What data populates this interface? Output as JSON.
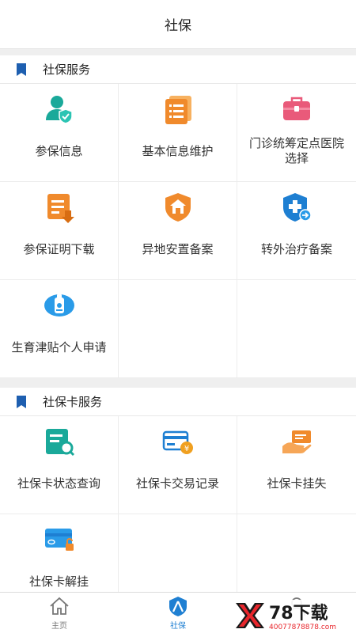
{
  "header": {
    "title": "社保"
  },
  "sections": [
    {
      "title": "社保服务",
      "items": [
        {
          "label": "参保信息",
          "icon": "user-shield-icon"
        },
        {
          "label": "基本信息维护",
          "icon": "document-list-icon"
        },
        {
          "label": "门诊统筹定点医院选择",
          "icon": "medical-kit-icon"
        },
        {
          "label": "参保证明下载",
          "icon": "download-document-icon"
        },
        {
          "label": "异地安置备案",
          "icon": "house-shield-icon"
        },
        {
          "label": "转外治疗备案",
          "icon": "medical-shield-transfer-icon"
        },
        {
          "label": "生育津贴个人申请",
          "icon": "baby-bottle-icon"
        }
      ]
    },
    {
      "title": "社保卡服务",
      "items": [
        {
          "label": "社保卡状态查询",
          "icon": "card-search-icon"
        },
        {
          "label": "社保卡交易记录",
          "icon": "card-transaction-icon"
        },
        {
          "label": "社保卡挂失",
          "icon": "card-hand-icon"
        },
        {
          "label": "社保卡解挂",
          "icon": "card-unlock-icon"
        }
      ]
    }
  ],
  "tabbar": {
    "items": [
      {
        "label": "主页",
        "icon": "home-icon"
      },
      {
        "label": "社保",
        "icon": "person-shield-icon",
        "active": true
      },
      {
        "label": "",
        "icon": "profile-icon"
      }
    ]
  },
  "watermark": {
    "brand": "78下载",
    "site": "40077878878.com"
  },
  "colors": {
    "accent": "#1e7fd2",
    "teal": "#1aa99a",
    "orange": "#f08a2c",
    "pink": "#e95a7a"
  }
}
